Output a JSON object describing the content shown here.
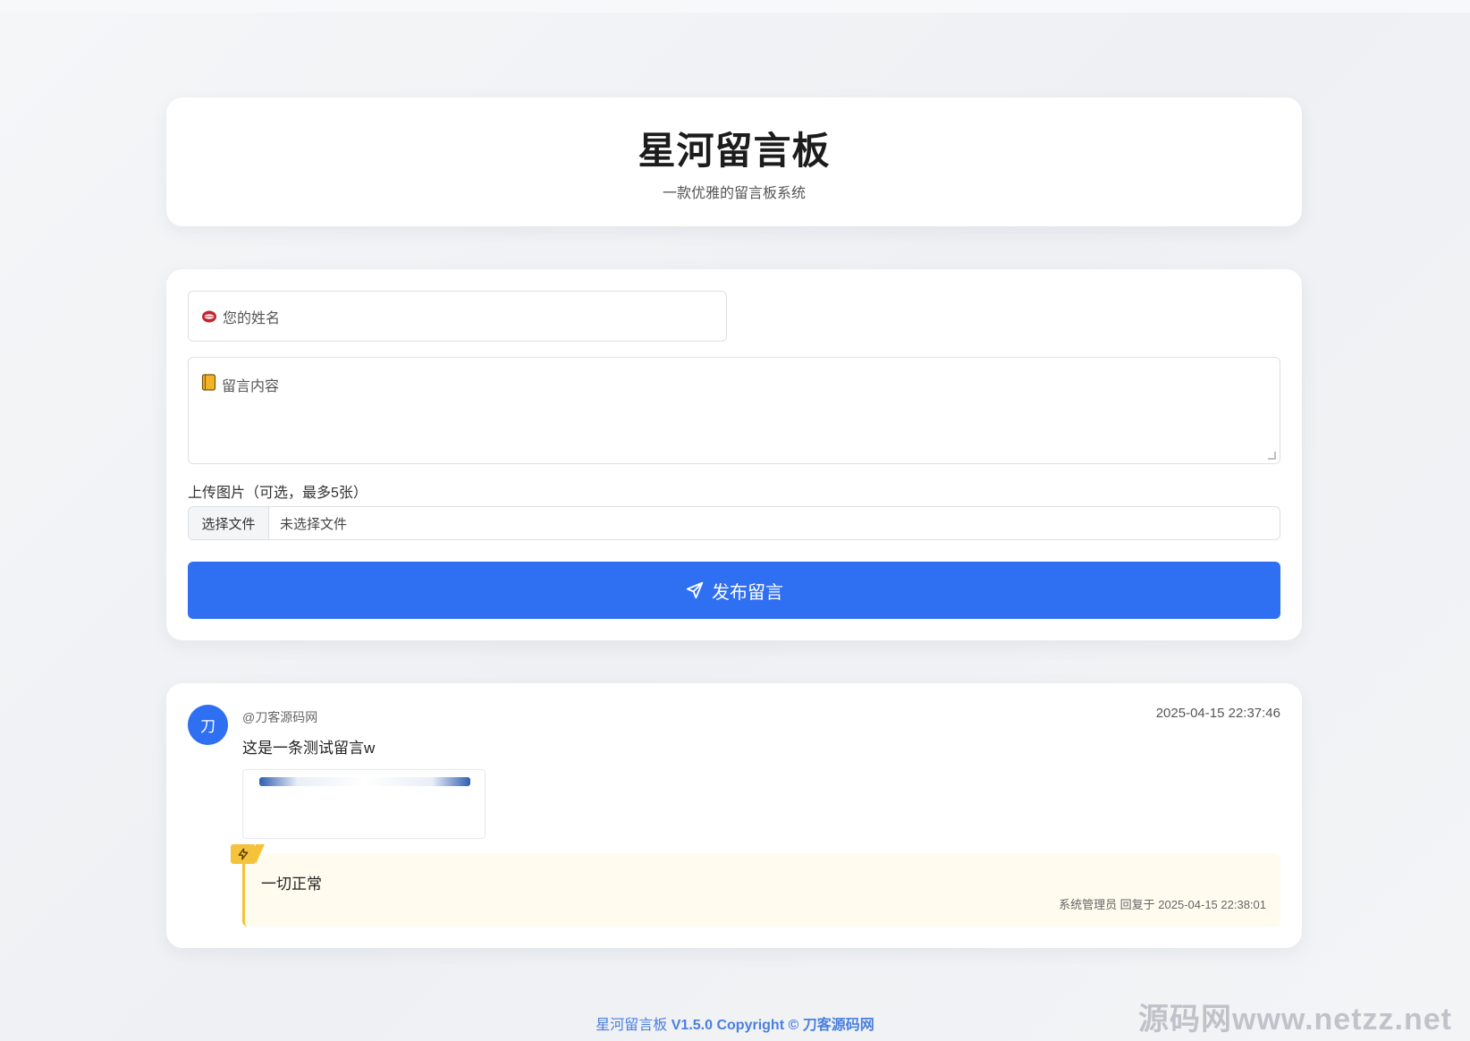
{
  "header": {
    "title": "星河留言板",
    "subtitle": "一款优雅的留言板系统"
  },
  "form": {
    "name_placeholder": "您的姓名",
    "name_icon": "mouth-emoji-icon",
    "content_placeholder": "留言内容",
    "content_icon": "notebook-emoji-icon",
    "upload_label": "上传图片（可选，最多5张）",
    "file_button": "选择文件",
    "file_status": "未选择文件",
    "submit_label": "发布留言",
    "submit_icon": "paper-plane-icon",
    "accent_color": "#2f6ff2"
  },
  "messages": [
    {
      "avatar_char": "刀",
      "user": "@刀客源码网",
      "time": "2025-04-15 22:37:46",
      "text": "这是一条测试留言w",
      "reply": {
        "badge_icon": "lightning-icon",
        "text": "一切正常",
        "meta": "系统管理员 回复于 2025-04-15 22:38:01",
        "color": "#f5c33b"
      }
    }
  ],
  "footer": {
    "brand": "星河留言板",
    "version": "V1.5.0",
    "copyright": "Copyright ©",
    "owner": "刀客源码网"
  },
  "watermark": "源码网www.netzz.net"
}
